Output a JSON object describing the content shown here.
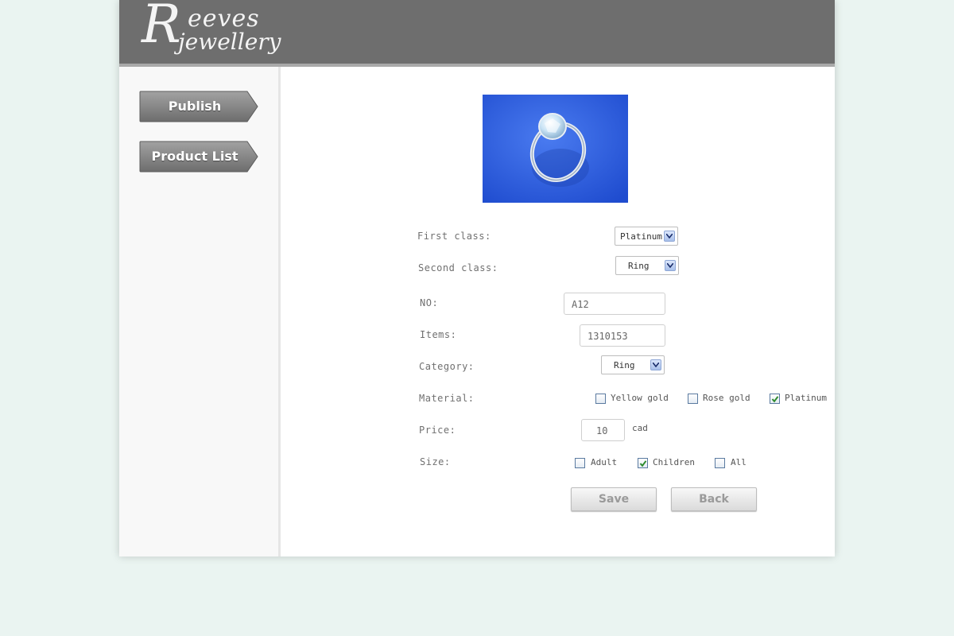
{
  "brand": {
    "logo_initial": "R",
    "logo_top": "eeves",
    "logo_bottom": "jewellery"
  },
  "colors": {
    "header": "#6e6e6e",
    "page_background": "#eaf4f1",
    "product_image_background": "#2f5fe0"
  },
  "sidebar": {
    "items": [
      {
        "label": "Publish"
      },
      {
        "label": "Product List"
      }
    ]
  },
  "product": {
    "image": "blue-ring-photo"
  },
  "form": {
    "first_class": {
      "label": "First class:",
      "value": "Platinum"
    },
    "second_class": {
      "label": "Second class:",
      "value": "Ring"
    },
    "no": {
      "label": "NO:",
      "value": "A12"
    },
    "items": {
      "label": "Items:",
      "value": "1310153"
    },
    "category": {
      "label": "Category:",
      "value": "Ring"
    },
    "material": {
      "label": "Material:",
      "options": [
        {
          "label": "Yellow gold",
          "checked": false
        },
        {
          "label": "Rose gold",
          "checked": false
        },
        {
          "label": "Platinum",
          "checked": true
        }
      ]
    },
    "price": {
      "label": "Price:",
      "value": "10",
      "unit": "cad"
    },
    "size": {
      "label": "Size:",
      "options": [
        {
          "label": "Adult",
          "checked": false
        },
        {
          "label": "Children",
          "checked": true
        },
        {
          "label": "All",
          "checked": false
        }
      ]
    }
  },
  "actions": {
    "save_label": "Save",
    "back_label": "Back"
  }
}
